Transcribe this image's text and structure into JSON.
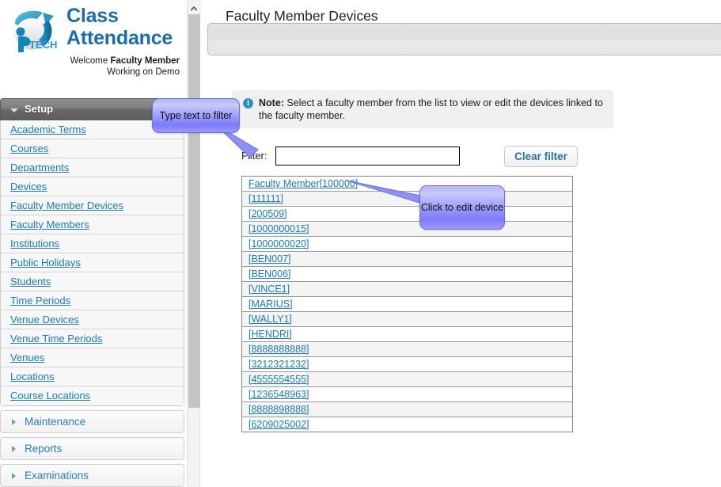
{
  "brand": {
    "logo_icon": "iptech-logo-icon",
    "title": "Class Attendance",
    "welcome_prefix": "Welcome ",
    "welcome_name": "Faculty Member",
    "welcome_line2": "Working on Demo"
  },
  "sidebar": {
    "setup": {
      "label": "Setup",
      "expanded": true,
      "items": [
        {
          "label": "Academic Terms"
        },
        {
          "label": "Courses"
        },
        {
          "label": "Departments"
        },
        {
          "label": "Devices"
        },
        {
          "label": "Faculty Member Devices"
        },
        {
          "label": "Faculty Members"
        },
        {
          "label": "Institutions"
        },
        {
          "label": "Public Holidays"
        },
        {
          "label": "Students"
        },
        {
          "label": "Time Periods"
        },
        {
          "label": "Venue Devices"
        },
        {
          "label": "Venue Time Periods"
        },
        {
          "label": "Venues"
        },
        {
          "label": "Locations"
        },
        {
          "label": "Course Locations"
        }
      ]
    },
    "sections": [
      {
        "label": "Maintenance"
      },
      {
        "label": "Reports"
      },
      {
        "label": "Examinations"
      }
    ]
  },
  "scrollbar": {
    "up_arrow_icon": "chevron-up-icon",
    "thumb_position": "top"
  },
  "main": {
    "page_title": "Faculty Member Devices",
    "note": {
      "icon": "info-icon",
      "icon_glyph": "i",
      "label": "Note:",
      "text": " Select a faculty member from the list to view or edit the devices linked to the faculty member."
    },
    "filter": {
      "label": "Filter:",
      "value": "",
      "placeholder": "",
      "clear_button": "Clear filter"
    },
    "device_list": [
      {
        "label": "Faculty Member[100000]"
      },
      {
        "label": "[111111]"
      },
      {
        "label": "[200509]"
      },
      {
        "label": "[1000000015]"
      },
      {
        "label": "[1000000020]"
      },
      {
        "label": "[BEN007]"
      },
      {
        "label": "[BEN006]"
      },
      {
        "label": "[VINCE1]"
      },
      {
        "label": "[MARIUS]"
      },
      {
        "label": "[WALLY1]"
      },
      {
        "label": "[HENDRI]"
      },
      {
        "label": "[8888888888]"
      },
      {
        "label": "[3212321232]"
      },
      {
        "label": "[4555554555]"
      },
      {
        "label": "[1236548963]"
      },
      {
        "label": "[8888898888]"
      },
      {
        "label": "[6209025002]"
      }
    ]
  },
  "callouts": {
    "filter_hint": "Type text to filter",
    "edit_hint": "Click to edit device"
  },
  "colors": {
    "brand_blue": "#1b6ca8",
    "link_blue": "#1b7ab5",
    "callout_purple": "#9b9bfd",
    "info_blue": "#2a8fc4",
    "setup_header_gray": "#696969"
  }
}
